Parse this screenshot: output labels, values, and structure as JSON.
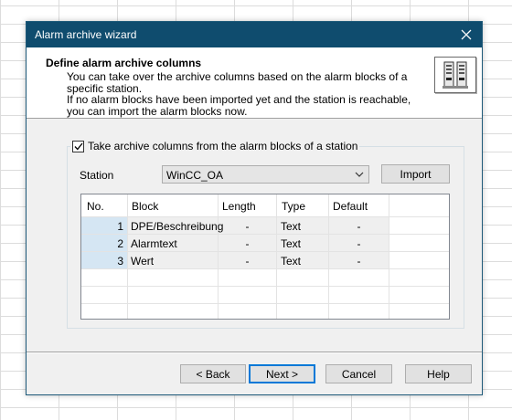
{
  "window": {
    "title": "Alarm archive wizard",
    "close_icon": "close-icon"
  },
  "header": {
    "title": "Define alarm archive columns",
    "desc_line1": "You can take over the archive columns based on the alarm blocks of a specific station.",
    "desc_line2": "If no alarm blocks have been imported yet and the station is reachable, you can import the alarm blocks now.",
    "icon": "archive-icon"
  },
  "options": {
    "take_columns_label": "Take archive columns from the alarm blocks of a station",
    "take_columns_checked": true
  },
  "station": {
    "label": "Station",
    "value": "WinCC_OA",
    "import_label": "Import"
  },
  "table": {
    "columns": [
      "No.",
      "Block",
      "Length",
      "Type",
      "Default"
    ],
    "rows": [
      {
        "no": "1",
        "block": "DPE/Beschreibung",
        "length": "-",
        "type": "Text",
        "default": "-"
      },
      {
        "no": "2",
        "block": "Alarmtext",
        "length": "-",
        "type": "Text",
        "default": "-"
      },
      {
        "no": "3",
        "block": "Wert",
        "length": "-",
        "type": "Text",
        "default": "-"
      }
    ]
  },
  "footer": {
    "back_label": "< Back",
    "next_label": "Next >",
    "cancel_label": "Cancel",
    "help_label": "Help"
  },
  "colors": {
    "titlebar": "#0f4c6e",
    "default_button_border": "#0078d7",
    "number_cell": "#d5e6f3"
  }
}
